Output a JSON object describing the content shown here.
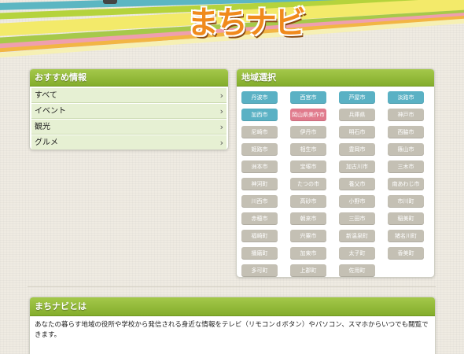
{
  "header": {
    "logo_text": "まちナビ"
  },
  "recommend": {
    "title": "おすすめ情報",
    "items": [
      {
        "label": "すべて"
      },
      {
        "label": "イベント"
      },
      {
        "label": "観光"
      },
      {
        "label": "グルメ"
      }
    ],
    "chevron": "›"
  },
  "region": {
    "title": "地域選択",
    "cities": [
      {
        "label": "丹波市",
        "state": "active"
      },
      {
        "label": "西宮市",
        "state": "active"
      },
      {
        "label": "芦屋市",
        "state": "active"
      },
      {
        "label": "淡路市",
        "state": "active"
      },
      {
        "label": "加西市",
        "state": "active"
      },
      {
        "label": "岡山県美作市",
        "state": "selected"
      },
      {
        "label": "兵庫県",
        "state": "inactive"
      },
      {
        "label": "神戸市",
        "state": "inactive"
      },
      {
        "label": "尼崎市",
        "state": "inactive"
      },
      {
        "label": "伊丹市",
        "state": "inactive"
      },
      {
        "label": "明石市",
        "state": "inactive"
      },
      {
        "label": "西脇市",
        "state": "inactive"
      },
      {
        "label": "姫路市",
        "state": "inactive"
      },
      {
        "label": "相生市",
        "state": "inactive"
      },
      {
        "label": "豊岡市",
        "state": "inactive"
      },
      {
        "label": "篠山市",
        "state": "inactive"
      },
      {
        "label": "洲本市",
        "state": "inactive"
      },
      {
        "label": "宝塚市",
        "state": "inactive"
      },
      {
        "label": "加古川市",
        "state": "inactive"
      },
      {
        "label": "三木市",
        "state": "inactive"
      },
      {
        "label": "神河町",
        "state": "inactive"
      },
      {
        "label": "たつの市",
        "state": "inactive"
      },
      {
        "label": "養父市",
        "state": "inactive"
      },
      {
        "label": "南あわじ市",
        "state": "inactive"
      },
      {
        "label": "川西市",
        "state": "inactive"
      },
      {
        "label": "高砂市",
        "state": "inactive"
      },
      {
        "label": "小野市",
        "state": "inactive"
      },
      {
        "label": "市川町",
        "state": "inactive"
      },
      {
        "label": "赤穂市",
        "state": "inactive"
      },
      {
        "label": "朝来市",
        "state": "inactive"
      },
      {
        "label": "三田市",
        "state": "inactive"
      },
      {
        "label": "稲美町",
        "state": "inactive"
      },
      {
        "label": "福崎町",
        "state": "inactive"
      },
      {
        "label": "宍粟市",
        "state": "inactive"
      },
      {
        "label": "新温泉町",
        "state": "inactive"
      },
      {
        "label": "猪名川町",
        "state": "inactive"
      },
      {
        "label": "播磨町",
        "state": "inactive"
      },
      {
        "label": "加東市",
        "state": "inactive"
      },
      {
        "label": "太子町",
        "state": "inactive"
      },
      {
        "label": "香美町",
        "state": "inactive"
      },
      {
        "label": "多可町",
        "state": "inactive"
      },
      {
        "label": "上郡町",
        "state": "inactive"
      },
      {
        "label": "佐用町",
        "state": "inactive"
      }
    ]
  },
  "about": {
    "title": "まちナビとは",
    "text": "あなたの暮らす地域の役所や学校から発信される身近な情報をテレビ（リモコンｄボタン）やパソコン、スマホからいつでも閲覧できます。"
  },
  "colors": {
    "accent_green": "#8cb534",
    "city_active": "#5ab1c4",
    "city_selected": "#e07a8c",
    "city_inactive": "#c4c0b4",
    "logo_orange": "#f08a1c"
  }
}
